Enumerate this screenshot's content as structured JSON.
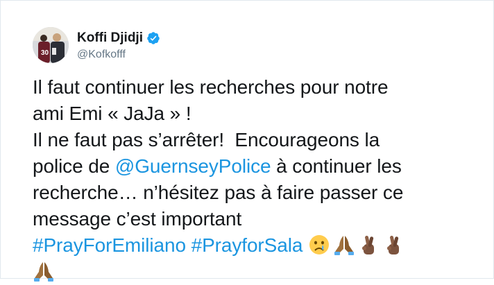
{
  "tweet": {
    "display_name": "Koffi Djidji",
    "handle": "@Kofkofff",
    "lines": [
      {
        "before": "Il faut continuer les recherches pour notre"
      },
      {
        "before": "ami Emi « JaJa » !"
      },
      {
        "before": "Il ne faut pas s’arrêter!  Encourageons la"
      },
      {
        "before": "police de ",
        "mention": "@GuernseyPolice",
        "after": " à continuer les"
      },
      {
        "before": "recherche… n’hésitez pas à faire passer ce"
      },
      {
        "before": "message c’est important"
      }
    ],
    "hashtags": [
      "#PrayForEmiliano",
      "#PrayforSala"
    ],
    "emojis": [
      "crying-face-emoji",
      "folded-hands-emoji",
      "crossed-fingers-emoji",
      "crossed-fingers-emoji",
      "folded-hands-emoji"
    ]
  },
  "colors": {
    "link": "#1b95e0",
    "text": "#14171a",
    "handle": "#657786",
    "verified": "#1da1f2"
  }
}
